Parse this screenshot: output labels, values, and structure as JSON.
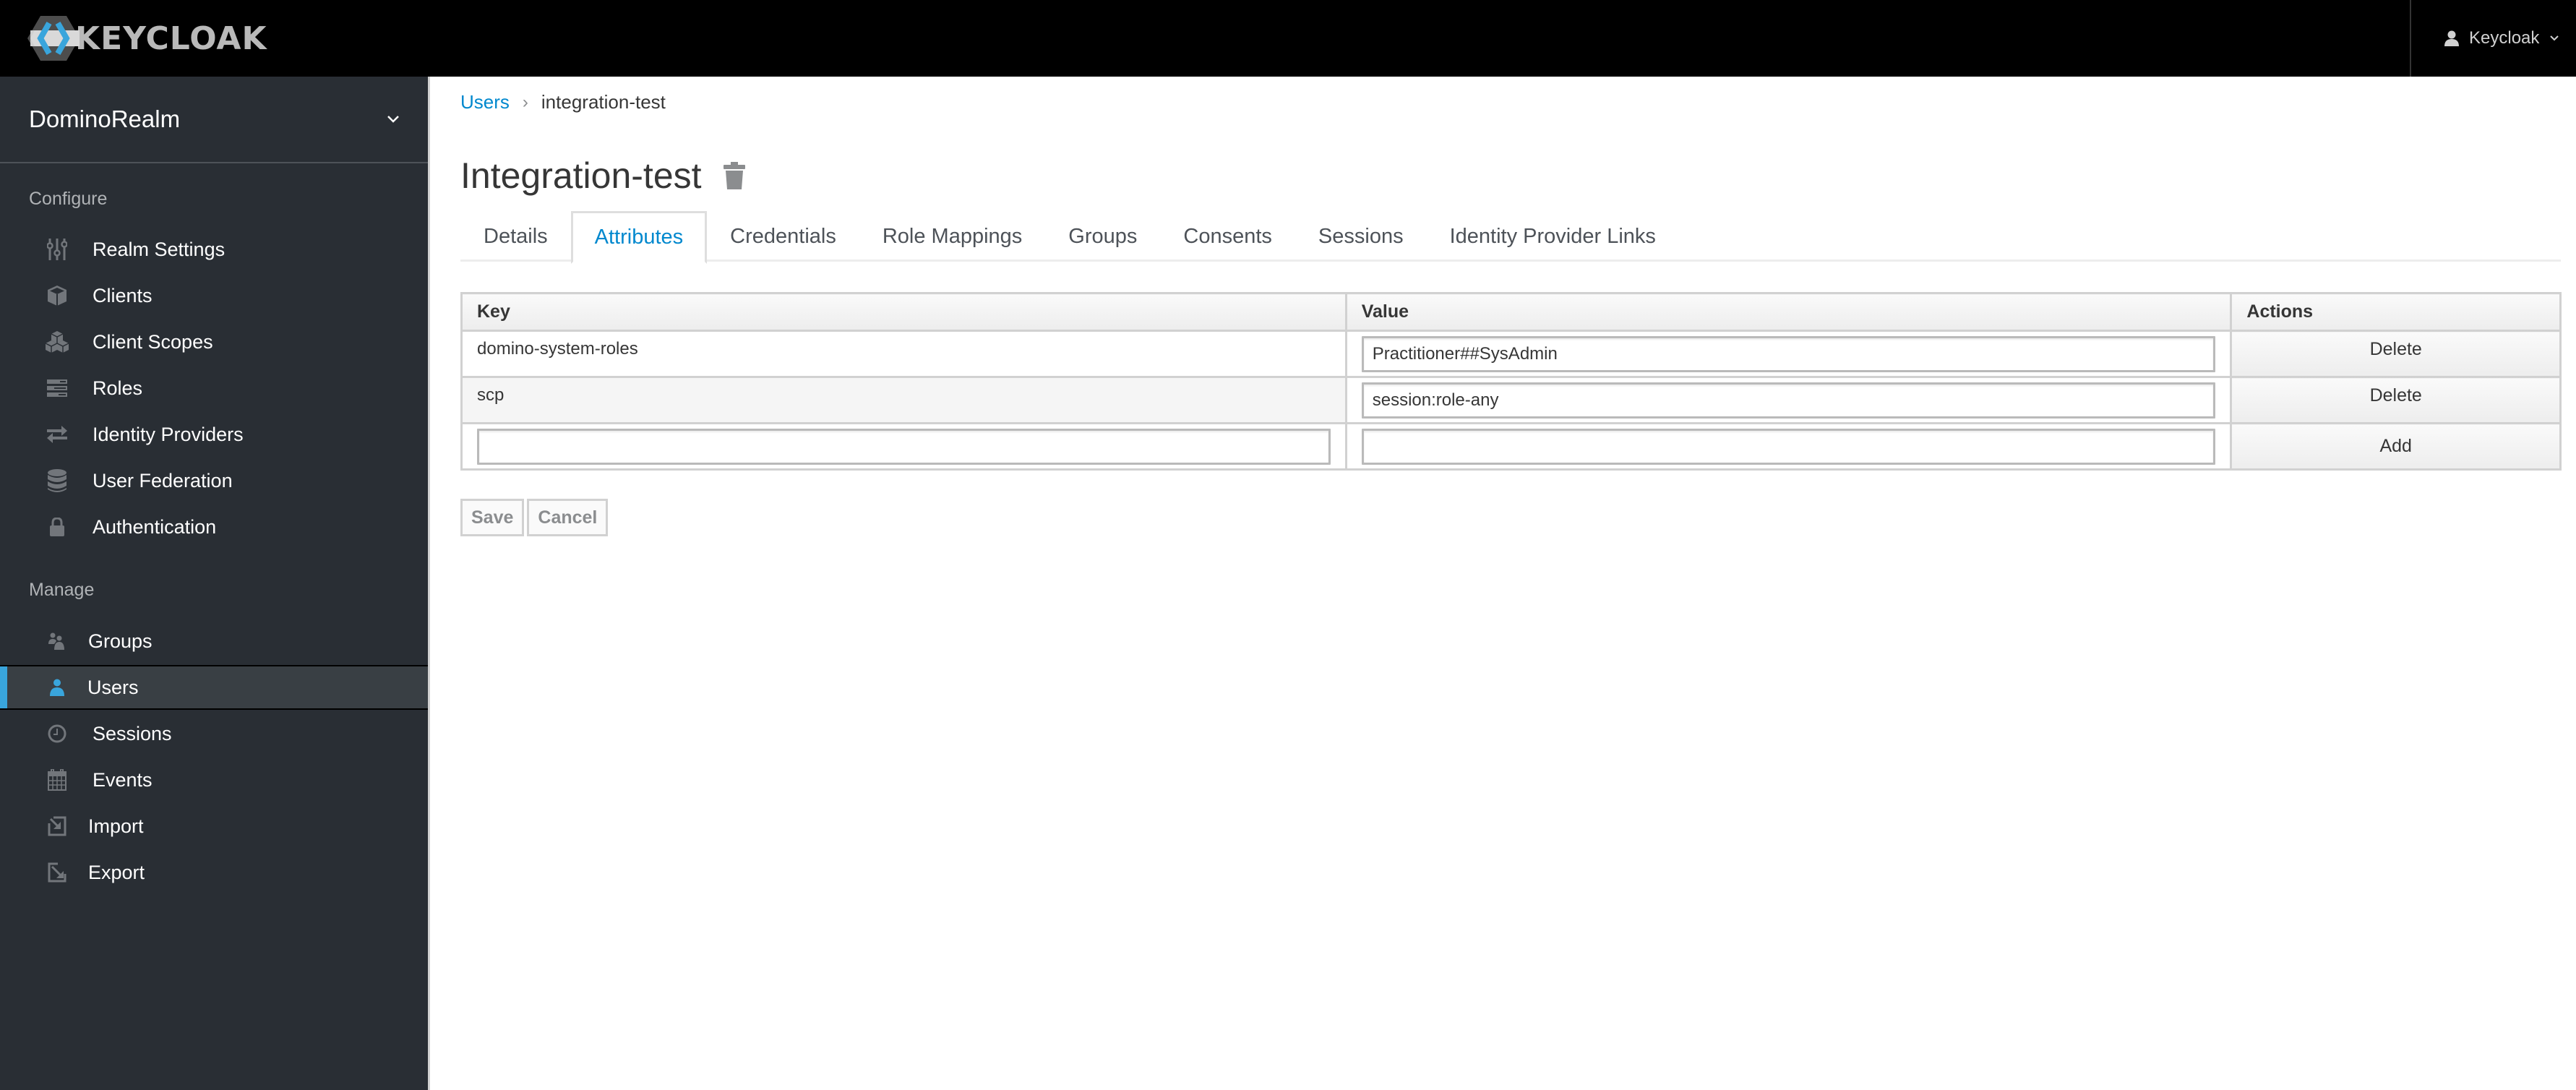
{
  "header": {
    "brand": "KEYCLOAK",
    "user_menu_label": "Keycloak"
  },
  "sidebar": {
    "realm": "DominoRealm",
    "sections": [
      {
        "title": "Configure",
        "items": [
          {
            "label": "Realm Settings",
            "icon": "sliders-icon"
          },
          {
            "label": "Clients",
            "icon": "cube-icon"
          },
          {
            "label": "Client Scopes",
            "icon": "cubes-icon"
          },
          {
            "label": "Roles",
            "icon": "server-icon"
          },
          {
            "label": "Identity Providers",
            "icon": "exchange-icon"
          },
          {
            "label": "User Federation",
            "icon": "database-icon"
          },
          {
            "label": "Authentication",
            "icon": "lock-icon"
          }
        ]
      },
      {
        "title": "Manage",
        "items": [
          {
            "label": "Groups",
            "icon": "users-icon"
          },
          {
            "label": "Users",
            "icon": "user-icon",
            "active": true
          },
          {
            "label": "Sessions",
            "icon": "clock-icon"
          },
          {
            "label": "Events",
            "icon": "calendar-icon"
          },
          {
            "label": "Import",
            "icon": "import-icon"
          },
          {
            "label": "Export",
            "icon": "export-icon"
          }
        ]
      }
    ]
  },
  "breadcrumb": {
    "parent": "Users",
    "separator": "›",
    "current": "integration-test"
  },
  "page": {
    "title": "Integration-test"
  },
  "tabs": [
    {
      "label": "Details"
    },
    {
      "label": "Attributes",
      "active": true
    },
    {
      "label": "Credentials"
    },
    {
      "label": "Role Mappings"
    },
    {
      "label": "Groups"
    },
    {
      "label": "Consents"
    },
    {
      "label": "Sessions"
    },
    {
      "label": "Identity Provider Links"
    }
  ],
  "attributes_table": {
    "columns": [
      "Key",
      "Value",
      "Actions"
    ],
    "rows": [
      {
        "key": "domino-system-roles",
        "value": "Practitioner##SysAdmin",
        "action": "Delete"
      },
      {
        "key": "scp",
        "value": "session:role-any",
        "action": "Delete"
      }
    ],
    "new_row": {
      "key": "",
      "value": "",
      "action": "Add"
    }
  },
  "form_buttons": {
    "save": "Save",
    "cancel": "Cancel"
  },
  "colors": {
    "accent": "#0088ce",
    "active_indicator": "#39a5dc",
    "sidebar_bg": "#292e34",
    "header_bg": "#000000"
  }
}
